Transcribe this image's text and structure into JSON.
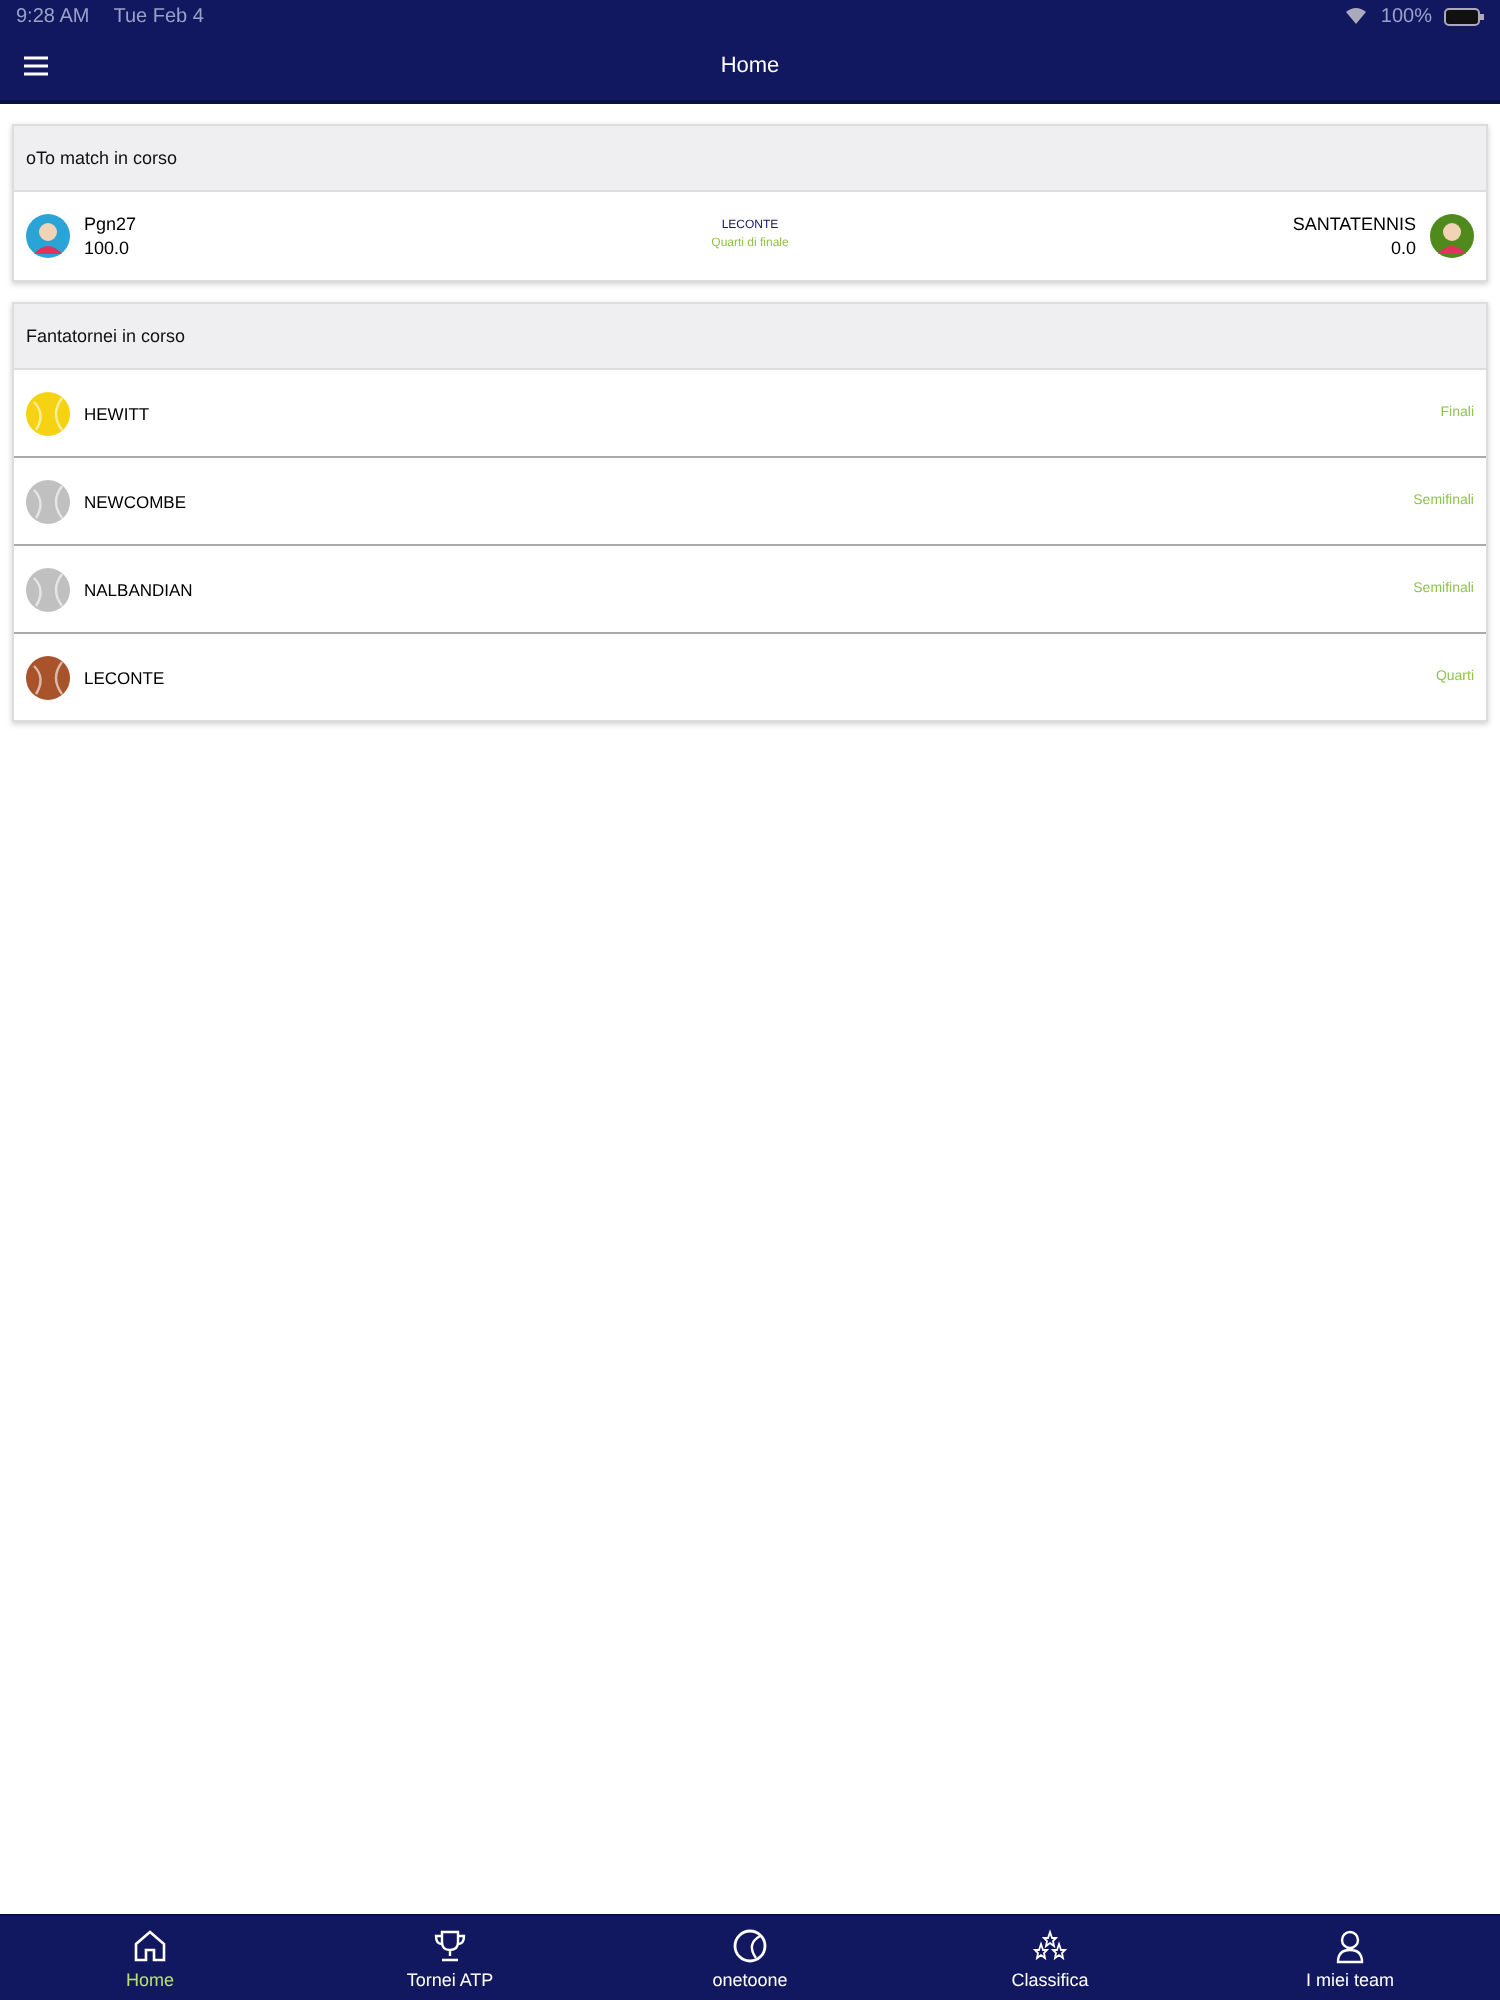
{
  "status_bar": {
    "time": "9:28 AM",
    "date": "Tue Feb 4",
    "battery": "100%"
  },
  "header": {
    "title": "Home"
  },
  "match_card": {
    "title": "oTo match in corso",
    "home": {
      "name": "Pgn27",
      "score": "100.0"
    },
    "tournament": "LECONTE",
    "round": "Quarti di finale",
    "away": {
      "name": "SANTATENNIS",
      "score": "0.0"
    }
  },
  "tournaments_card": {
    "title": "Fantatornei in corso",
    "items": [
      {
        "name": "HEWITT",
        "stage": "Finali",
        "color": "#f5d312"
      },
      {
        "name": "NEWCOMBE",
        "stage": "Semifinali",
        "color": "#c0c0c0"
      },
      {
        "name": "NALBANDIAN",
        "stage": "Semifinali",
        "color": "#c0c0c0"
      },
      {
        "name": "LECONTE",
        "stage": "Quarti",
        "color": "#a8532c"
      }
    ]
  },
  "tab_bar": [
    {
      "label": "Home",
      "kind": "home",
      "selected": true
    },
    {
      "label": "Tornei ATP",
      "kind": "trophy",
      "selected": false
    },
    {
      "label": "onetoone",
      "kind": "ball",
      "selected": false
    },
    {
      "label": "Classifica",
      "kind": "stars",
      "selected": false
    },
    {
      "label": "I miei team",
      "kind": "person",
      "selected": false
    }
  ]
}
